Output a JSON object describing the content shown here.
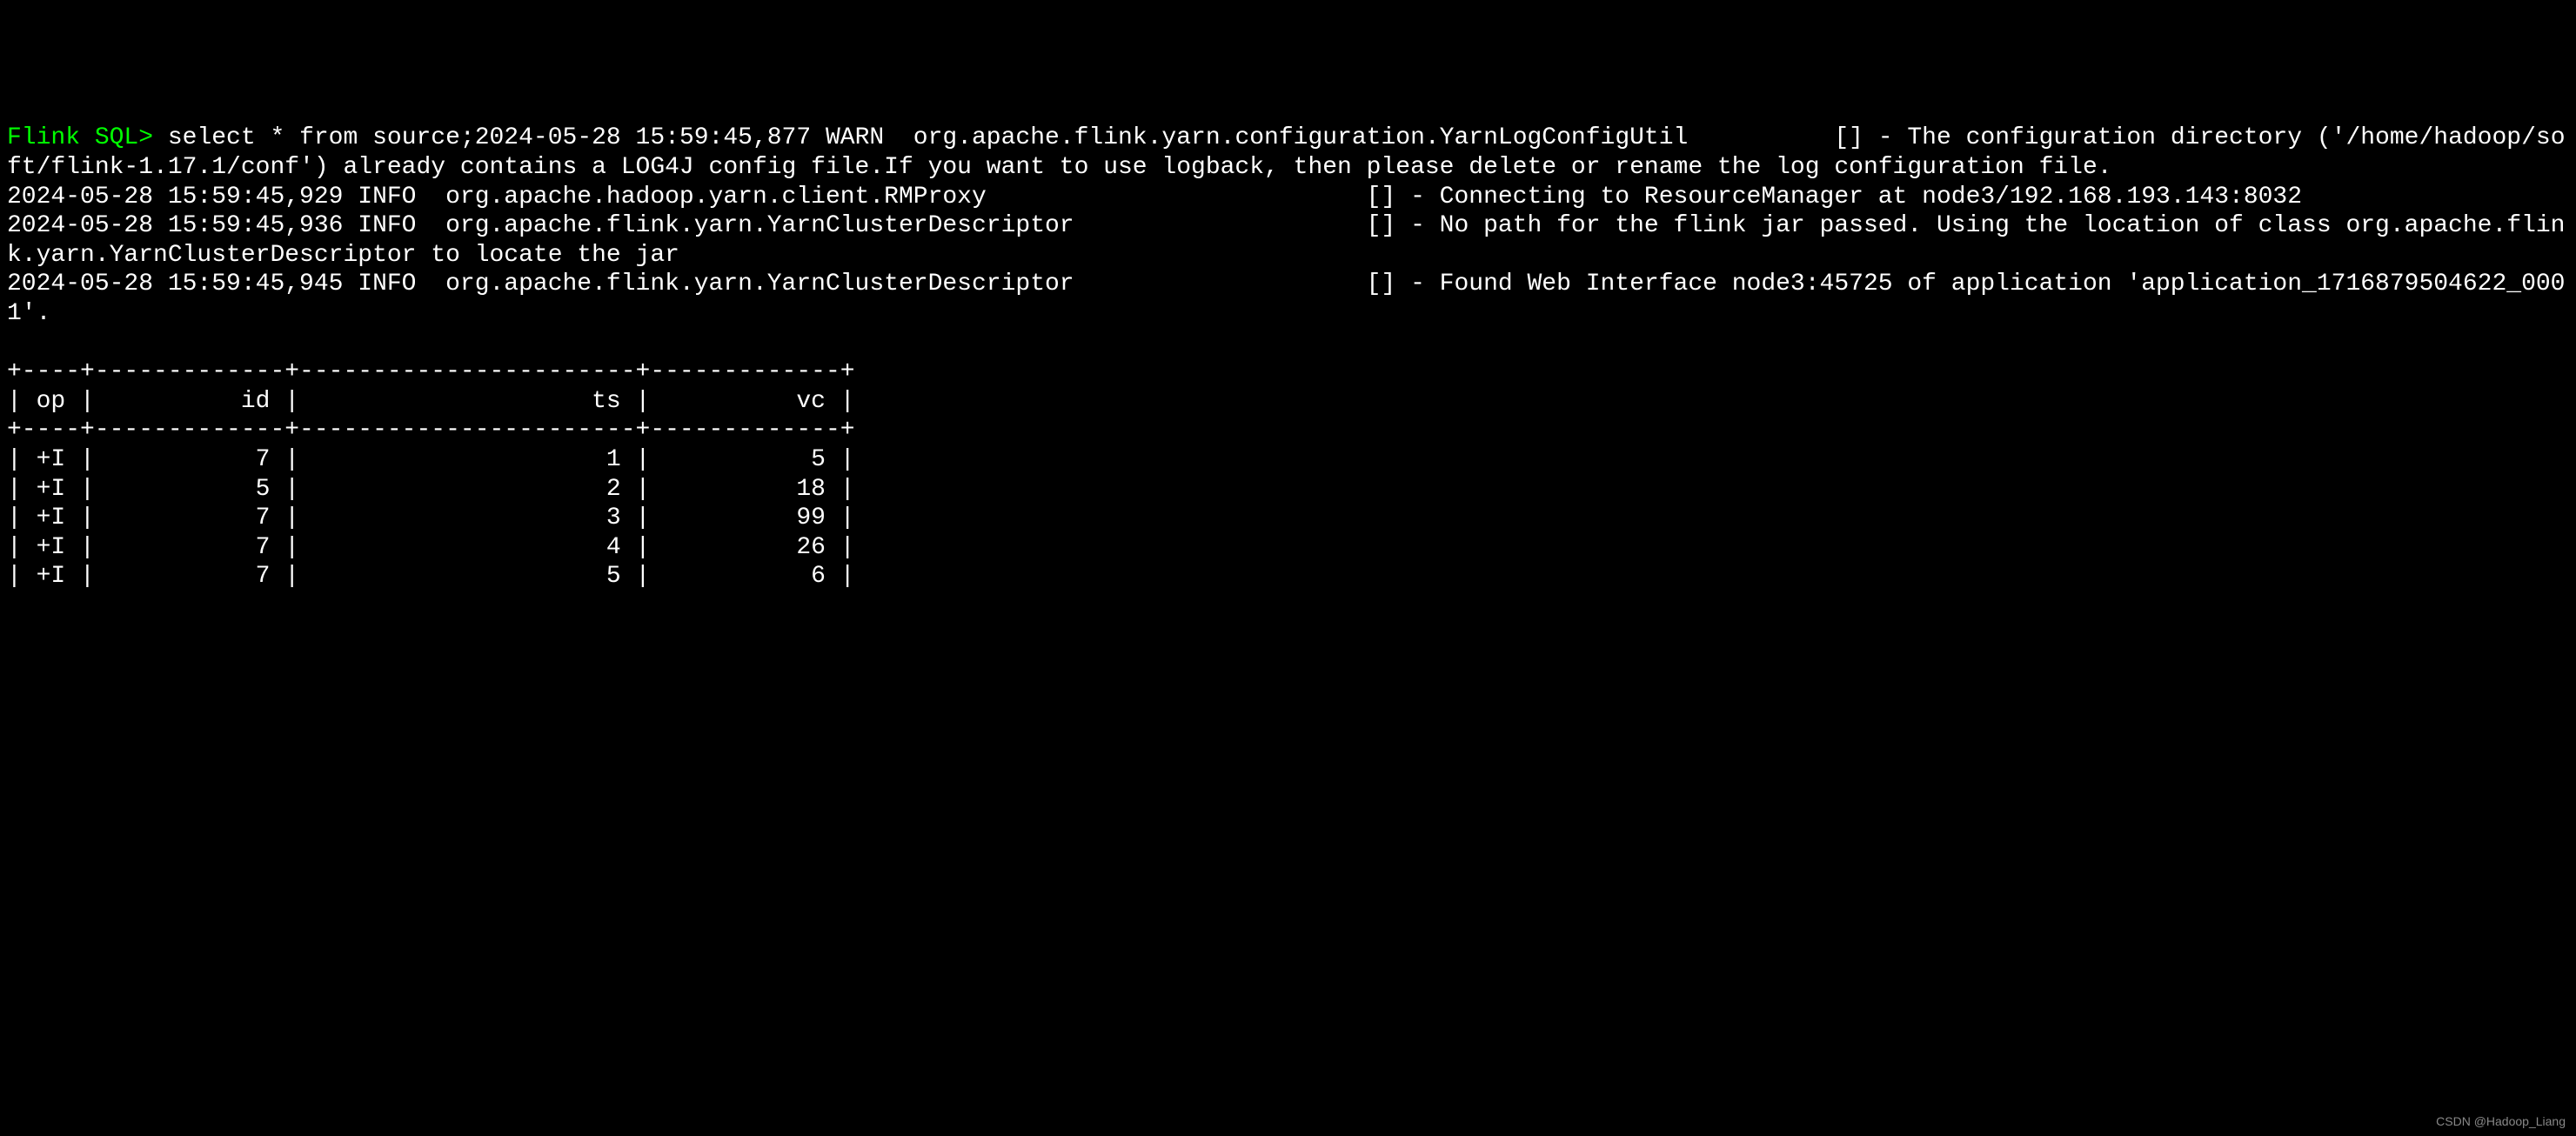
{
  "prompt": "Flink SQL",
  "prompt_suffix": "> ",
  "command": "select * from source;",
  "log_lines": [
    "2024-05-28 15:59:45,877 WARN  org.apache.flink.yarn.configuration.YarnLogConfigUtil          [] - The configuration directory ('/home/hadoop/soft/flink-1.17.1/conf') already contains a LOG4J config file.If you want to use logback, then please delete or rename the log configuration file.",
    "2024-05-28 15:59:45,929 INFO  org.apache.hadoop.yarn.client.RMProxy                          [] - Connecting to ResourceManager at node3/192.168.193.143:8032",
    "2024-05-28 15:59:45,936 INFO  org.apache.flink.yarn.YarnClusterDescriptor                    [] - No path for the flink jar passed. Using the location of class org.apache.flink.yarn.YarnClusterDescriptor to locate the jar",
    "2024-05-28 15:59:45,945 INFO  org.apache.flink.yarn.YarnClusterDescriptor                    [] - Found Web Interface node3:45725 of application 'application_1716879504622_0001'."
  ],
  "table": {
    "border_top": "+----+-------------+-----------------------+-------------+",
    "header_row": "| op |          id |                    ts |          vc |",
    "border_mid": "+----+-------------+-----------------------+-------------+",
    "columns": [
      "op",
      "id",
      "ts",
      "vc"
    ],
    "rows": [
      {
        "op": "+I",
        "id": "7",
        "ts": "1",
        "vc": "5"
      },
      {
        "op": "+I",
        "id": "5",
        "ts": "2",
        "vc": "18"
      },
      {
        "op": "+I",
        "id": "7",
        "ts": "3",
        "vc": "99"
      },
      {
        "op": "+I",
        "id": "7",
        "ts": "4",
        "vc": "26"
      },
      {
        "op": "+I",
        "id": "7",
        "ts": "5",
        "vc": "6"
      }
    ]
  },
  "watermark": "CSDN @Hadoop_Liang"
}
